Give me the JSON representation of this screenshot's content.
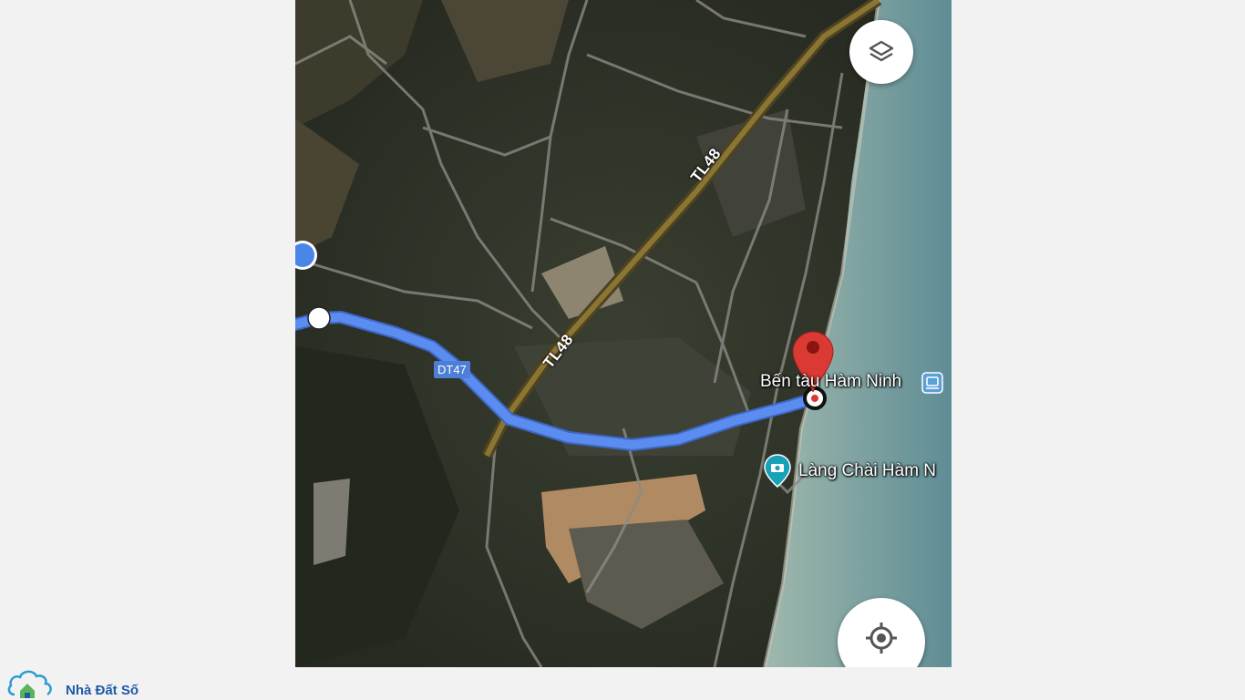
{
  "map": {
    "roads": [
      {
        "label": "TL48"
      },
      {
        "label": "TL48"
      }
    ],
    "route_badge": "DT47",
    "places": [
      {
        "name": "Bến tàu Hàm Ninh",
        "icon": "ferry-icon"
      },
      {
        "name": "Làng Chài Hàm N",
        "icon": "camera-pin-icon"
      }
    ],
    "colors": {
      "route": "#4d7fd6",
      "destination_pin": "#db3a34",
      "water": "#6f9aa1",
      "my_location": "#4a86e8"
    }
  },
  "controls": {
    "layers_button": "layers-icon",
    "my_location_button": "crosshair-icon"
  },
  "watermark": {
    "text": "Nhà Đất Số"
  }
}
